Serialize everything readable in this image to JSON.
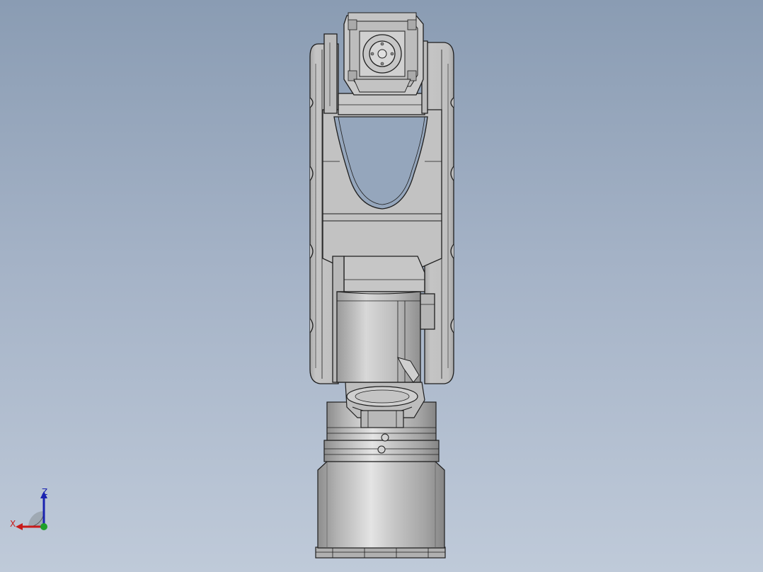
{
  "viewport": {
    "background_top": "#8a9cb3",
    "background_bottom": "#bfcad9"
  },
  "model": {
    "body_color": "#c2c2c2",
    "edge_color": "#1e1e1e"
  },
  "triad": {
    "z_label": "Z",
    "x_label": "X",
    "z_color": "#1a22b0",
    "x_color": "#c81a1a",
    "y_color": "#1fa02a"
  }
}
